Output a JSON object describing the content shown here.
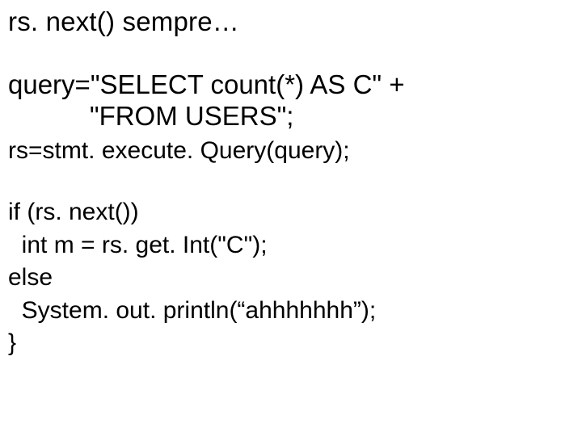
{
  "title": "rs. next() sempre…",
  "block1": {
    "l1": "query=\"SELECT count(*) AS C\" +",
    "l2": "           \"FROM USERS\";"
  },
  "block2": {
    "l1": "rs=stmt. execute. Query(query);",
    "l2": "if (rs. next())",
    "l3": "  int m = rs. get. Int(\"C\");",
    "l4": "else",
    "l5": "  System. out. println(“ahhhhhhh”);",
    "l6": "}"
  }
}
